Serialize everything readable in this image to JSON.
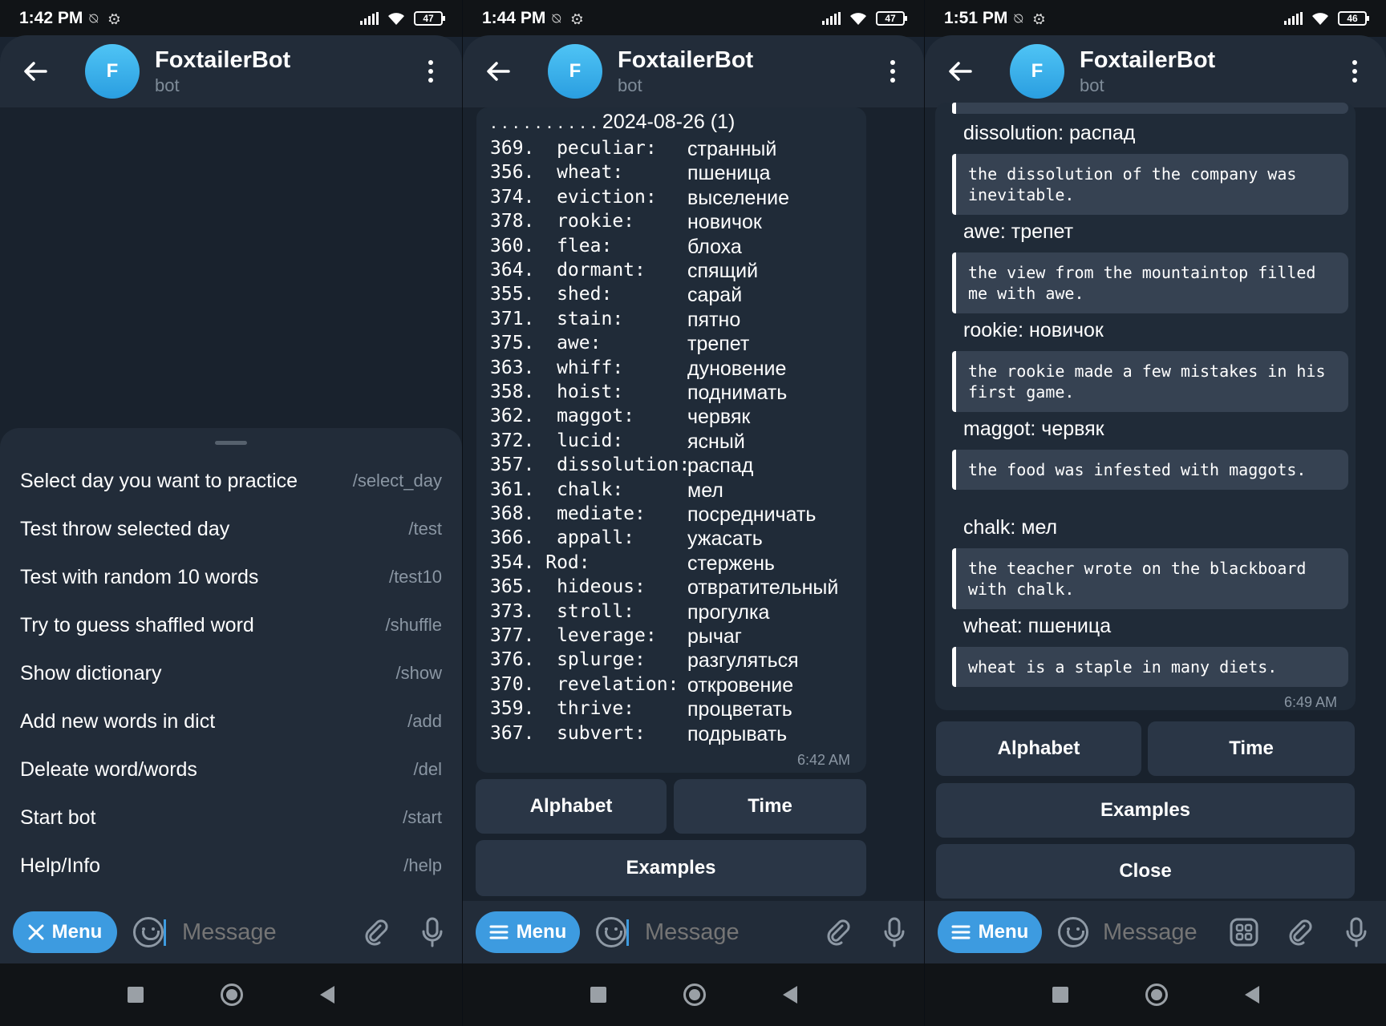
{
  "screens": [
    {
      "status_time": "1:42 PM",
      "battery": "47",
      "title": "FoxtailerBot",
      "subtitle": "bot",
      "avatar_letter": "F"
    },
    {
      "status_time": "1:44 PM",
      "battery": "47",
      "title": "FoxtailerBot",
      "subtitle": "bot",
      "avatar_letter": "F"
    },
    {
      "status_time": "1:51 PM",
      "battery": "46",
      "title": "FoxtailerBot",
      "subtitle": "bot",
      "avatar_letter": "F"
    }
  ],
  "bot_menu": [
    {
      "label": "Select day you want to practice",
      "command": "/select_day"
    },
    {
      "label": "Test throw selected day",
      "command": "/test"
    },
    {
      "label": "Test with random 10 words",
      "command": "/test10"
    },
    {
      "label": "Try to guess shaffled word",
      "command": "/shuffle"
    },
    {
      "label": "Show dictionary",
      "command": "/show"
    },
    {
      "label": "Add new words in dict",
      "command": "/add"
    },
    {
      "label": "Deleate word/words",
      "command": "/del"
    },
    {
      "label": "Start bot",
      "command": "/start"
    },
    {
      "label": "Help/Info",
      "command": "/help"
    }
  ],
  "dictionary": {
    "date_line": ". . . . . . . . . . 2024-08-26 (1)",
    "entries": [
      {
        "en": "369.  peculiar:",
        "ru": "странный"
      },
      {
        "en": "356.  wheat:",
        "ru": "пшеница"
      },
      {
        "en": "374.  eviction:",
        "ru": "выселение"
      },
      {
        "en": "378.  rookie:",
        "ru": "новичок"
      },
      {
        "en": "360.  flea:",
        "ru": "блоха"
      },
      {
        "en": "364.  dormant:",
        "ru": "спящий"
      },
      {
        "en": "355.  shed:",
        "ru": "сарай"
      },
      {
        "en": "371.  stain:",
        "ru": "пятно"
      },
      {
        "en": "375.  awe:",
        "ru": "трепет"
      },
      {
        "en": "363.  whiff:",
        "ru": "дуновение"
      },
      {
        "en": "358.  hoist:",
        "ru": "поднимать"
      },
      {
        "en": "362.  maggot:",
        "ru": "червяк"
      },
      {
        "en": "372.  lucid:",
        "ru": "ясный"
      },
      {
        "en": "357.  dissolution:",
        "ru": "распад"
      },
      {
        "en": "361.  chalk:",
        "ru": "мел"
      },
      {
        "en": "368.  mediate:",
        "ru": "посредничать"
      },
      {
        "en": "366.  appall:",
        "ru": "ужасать"
      },
      {
        "en": "354. Rod:",
        "ru": "стержень"
      },
      {
        "en": "365.  hideous:",
        "ru": "отвратительный"
      },
      {
        "en": "373.  stroll:",
        "ru": "прогулка"
      },
      {
        "en": "377.  leverage:",
        "ru": "рычаг"
      },
      {
        "en": "376.  splurge:",
        "ru": "разгуляться"
      },
      {
        "en": "370.  revelation:",
        "ru": "откровение"
      },
      {
        "en": "359.  thrive:",
        "ru": "процветать"
      },
      {
        "en": "367.  subvert:",
        "ru": "подрывать"
      }
    ],
    "time": "6:42 AM"
  },
  "examples": {
    "items": [
      {
        "word": "dissolution:",
        "ru": "распад",
        "sentence": "the dissolution of the company was inevitable."
      },
      {
        "word": "awe:",
        "ru": "трепет",
        "sentence": "the view from the mountaintop filled me with awe."
      },
      {
        "word": "rookie:",
        "ru": "новичок",
        "sentence": "the rookie made a few mistakes in his first game."
      },
      {
        "word": "maggot:",
        "ru": "червяк",
        "sentence": "the food was infested with maggots."
      },
      {
        "word": "chalk:",
        "ru": "мел",
        "sentence": "the teacher wrote on the blackboard with chalk."
      },
      {
        "word": "wheat:",
        "ru": "пшеница",
        "sentence": "wheat is a staple in many diets."
      }
    ],
    "time": "6:49 AM"
  },
  "keyboard": {
    "alphabet": "Alphabet",
    "time": "Time",
    "examples": "Examples",
    "close": "Close"
  },
  "input": {
    "menu_label": "Menu",
    "placeholder": "Message"
  },
  "colors": {
    "accent": "#3d9be0",
    "header_bg": "#222c39",
    "chat_bg": "#19222d",
    "avatar": "#3aaeea"
  }
}
